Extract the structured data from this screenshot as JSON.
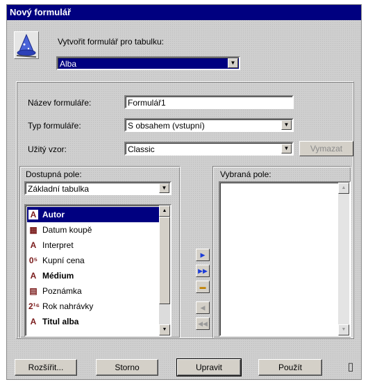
{
  "window": {
    "title": "Nový formulář"
  },
  "header": {
    "create_label": "Vytvořit formulář pro tabulku:",
    "table_value": "Alba"
  },
  "form": {
    "name_label": "Název formuláře:",
    "name_value": "Formulář1",
    "type_label": "Typ formuláře:",
    "type_value": "S obsahem (vstupní)",
    "template_label": "Užitý vzor:",
    "template_value": "Classic",
    "delete_button": "Vymazat"
  },
  "available": {
    "label": "Dostupná pole:",
    "source_value": "Základní tabulka",
    "items": [
      {
        "label": "Autor",
        "icon": "text-field-icon",
        "glyph": "A",
        "bold": true,
        "selected": true
      },
      {
        "label": "Datum koupě",
        "icon": "date-field-icon",
        "glyph": "▦",
        "bold": false,
        "selected": false
      },
      {
        "label": "Interpret",
        "icon": "text-field-icon",
        "glyph": "A",
        "bold": false,
        "selected": false
      },
      {
        "label": "Kupní cena",
        "icon": "currency-field-icon",
        "glyph": "0⁵",
        "bold": false,
        "selected": false
      },
      {
        "label": "Médium",
        "icon": "text-field-icon",
        "glyph": "A",
        "bold": true,
        "selected": false
      },
      {
        "label": "Poznámka",
        "icon": "memo-field-icon",
        "glyph": "▤",
        "bold": false,
        "selected": false
      },
      {
        "label": "Rok nahrávky",
        "icon": "number-field-icon",
        "glyph": "2¹⁶",
        "bold": false,
        "selected": false
      },
      {
        "label": "Titul alba",
        "icon": "text-field-icon",
        "glyph": "A",
        "bold": true,
        "selected": false
      }
    ]
  },
  "selected": {
    "label": "Vybraná pole:"
  },
  "buttons": {
    "expand": "Rozšířit...",
    "cancel": "Storno",
    "edit": "Upravit",
    "apply": "Použít"
  }
}
